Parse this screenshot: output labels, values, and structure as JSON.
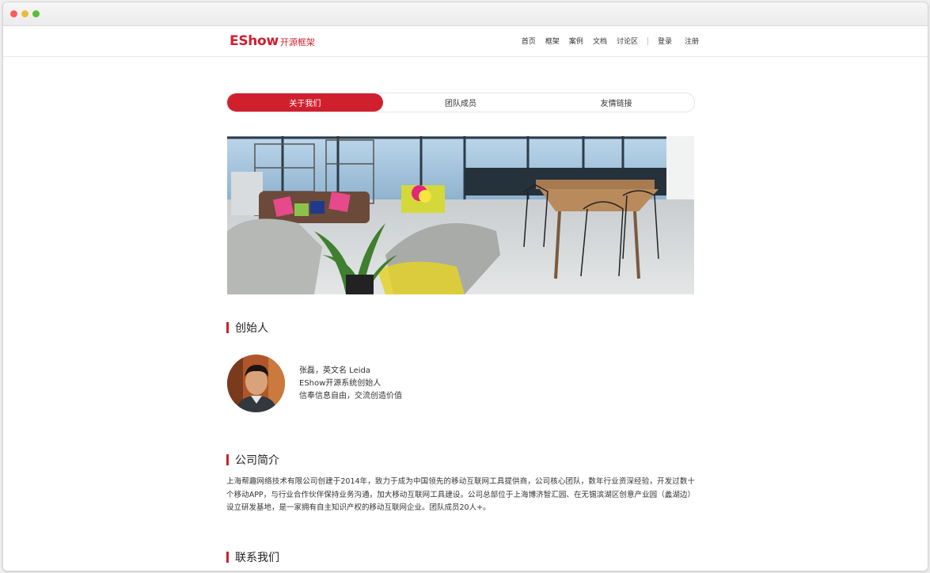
{
  "brand": {
    "main": "EShow",
    "sub": "开源框架",
    "color": "#d0202e"
  },
  "nav": {
    "items": [
      "首页",
      "框架",
      "案例",
      "文档",
      "讨论区"
    ],
    "login": "登录",
    "register": "注册"
  },
  "tabs": [
    {
      "label": "关于我们",
      "active": true
    },
    {
      "label": "团队成员",
      "active": false
    },
    {
      "label": "友情链接",
      "active": false
    }
  ],
  "founder": {
    "heading": "创始人",
    "lines": [
      "张磊，英文名 Leida",
      "EShow开源系统创始人",
      "信奉信息自由，交流创造价值"
    ]
  },
  "company": {
    "heading": "公司简介",
    "text": "上海帮趣网络技术有限公司创建于2014年，致力于成为中国领先的移动互联网工具提供商，公司核心团队，数年行业资深经验，开发过数十个移动APP，与行业合作伙伴保持业务沟通，加大移动互联网工具建设。公司总部位于上海博济智汇园、在无锡滨湖区创意产业园（蠡湖边）设立研发基地，是一家拥有自主知识产权的移动互联网企业。团队成员20人+。"
  },
  "contact": {
    "heading": "联系我们"
  }
}
